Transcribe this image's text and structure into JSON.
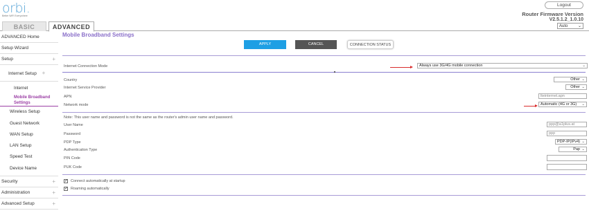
{
  "brand": {
    "logo": "orbi.",
    "tagline": "Better WiFi Everywhere"
  },
  "tabs": {
    "basic": "BASIC",
    "advanced": "ADVANCED"
  },
  "header": {
    "logout": "Logout",
    "fw_title": "Router Firmware Version",
    "fw_version": "V2.5.1.2_1.0.10",
    "language": "Auto"
  },
  "sidebar": {
    "advanced_home": "ADVANCED Home",
    "setup_wizard": "Setup Wizard",
    "setup": "Setup",
    "internet_setup": "Internet Setup",
    "internet": "Internet",
    "mobile_broadband": "Mobile Broadband Settings",
    "wireless_setup": "Wireless Setup",
    "guest_network": "Guest Network",
    "wan_setup": "WAN Setup",
    "lan_setup": "LAN Setup",
    "speed_test": "Speed Test",
    "device_name": "Device Name",
    "security": "Security",
    "administration": "Administration",
    "advanced_setup": "Advanced Setup"
  },
  "main": {
    "title": "Mobile Broadband Settings",
    "apply": "APPLY",
    "cancel": "CANCEL",
    "connection_status": "CONNECTION STATUS",
    "internet_connection_mode_label": "Internet Connection Mode",
    "internet_connection_mode_value": "Always use 3G/4G mobile connection",
    "country_label": "Country",
    "country_value": "Other",
    "isp_label": "Internet Service Provider",
    "isp_value": "Other",
    "apn_label": "APN",
    "apn_value": "lteinternet.apn",
    "network_mode_label": "Network mode",
    "network_mode_value": "Automatic (4G or 3G)",
    "note": "Note: This user name and password is not the same as the router's admin user name and password.",
    "username_label": "User Name",
    "username_value": "ppp@a1plus.at",
    "password_label": "Password",
    "password_value": "ppp",
    "pdp_type_label": "PDP Type",
    "pdp_type_value": "PDP-IP(IPv4)",
    "auth_type_label": "Authentication Type",
    "auth_type_value": "Pap",
    "pin_code_label": "PIN Code",
    "pin_code_value": "",
    "puk_code_label": "PUK Code",
    "puk_code_value": "",
    "connect_auto_label": "Connect automatically at startup",
    "roaming_auto_label": "Roaming automatically"
  },
  "colors": {
    "accent": "#1e9fe4",
    "active": "#9b3fa5",
    "rule": "#a79ad6",
    "arrow": "#d92b2b"
  }
}
